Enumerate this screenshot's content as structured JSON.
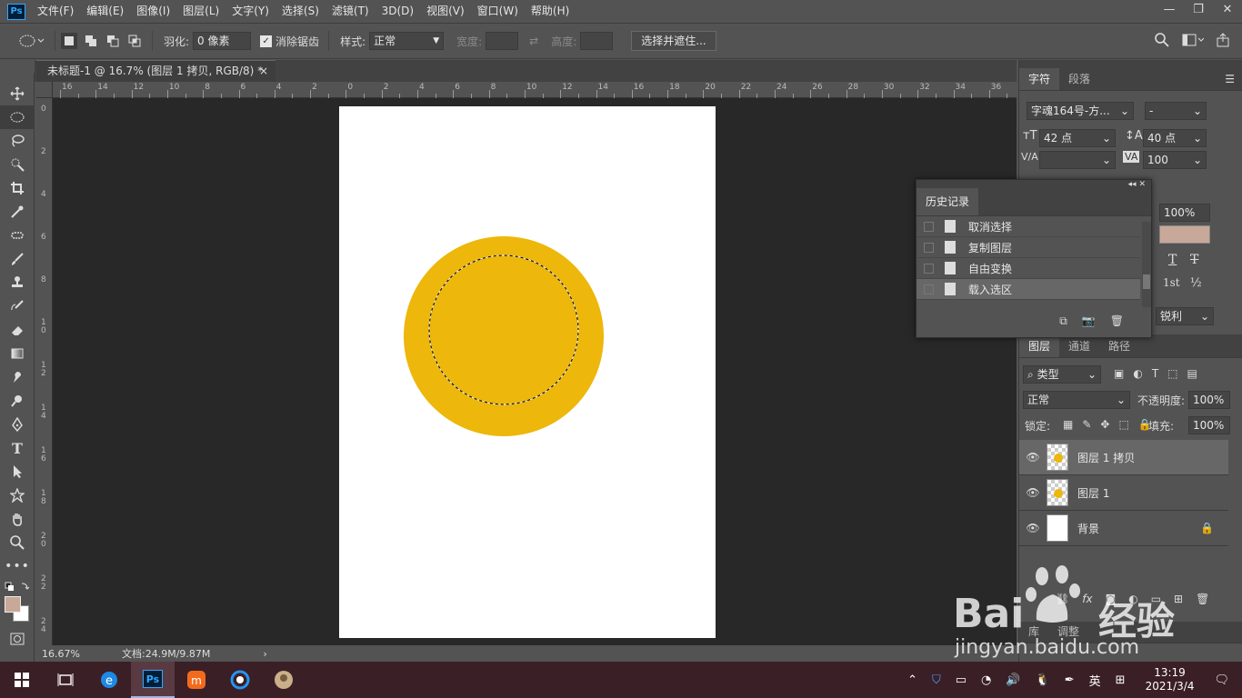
{
  "menubar": {
    "logo": "Ps",
    "items": [
      "文件(F)",
      "编辑(E)",
      "图像(I)",
      "图层(L)",
      "文字(Y)",
      "选择(S)",
      "滤镜(T)",
      "3D(D)",
      "视图(V)",
      "窗口(W)",
      "帮助(H)"
    ],
    "win": {
      "min": "—",
      "restore": "❐",
      "close": "✕"
    }
  },
  "options": {
    "feather_label": "羽化:",
    "feather_value": "0 像素",
    "antialias_label": "消除锯齿",
    "style_label": "样式:",
    "style_value": "正常",
    "width_label": "宽度:",
    "height_label": "高度:",
    "select_mask_button": "选择并遮住..."
  },
  "document": {
    "tab_title": "未标题-1 @ 16.7% (图层 1 拷贝, RGB/8) *",
    "close": "×",
    "zoom": "16.67%",
    "doc_info": "文档:24.9M/9.87M",
    "circle_color": "#edb70b"
  },
  "ruler_h": [
    "16",
    "14",
    "12",
    "10",
    "8",
    "6",
    "4",
    "2",
    "0",
    "2",
    "4",
    "6",
    "8",
    "10",
    "12",
    "14",
    "16",
    "18",
    "20",
    "22",
    "24",
    "26",
    "28",
    "30",
    "32",
    "34",
    "36"
  ],
  "ruler_v": [
    "0",
    "2",
    "4",
    "6",
    "8",
    "1\n0",
    "1\n2",
    "1\n4",
    "1\n6",
    "1\n8",
    "2\n0",
    "2\n2",
    "2\n4"
  ],
  "character": {
    "tabs": [
      "字符",
      "段落"
    ],
    "font_family": "字魂164号-方...",
    "font_style": "-",
    "size": "42 点",
    "leading": "40 点",
    "kerning": "",
    "tracking": "100",
    "scale": "100%",
    "color": "#c8a898",
    "aa": "锐利",
    "glyph_T": "T",
    "glyph_1st": "1st",
    "glyph_half": "½"
  },
  "history": {
    "title": "历史记录",
    "items": [
      "取消选择",
      "复制图层",
      "自由变换",
      "载入选区"
    ]
  },
  "layers": {
    "tabs": [
      "图层",
      "通道",
      "路径"
    ],
    "filter": "类型",
    "blend": "正常",
    "opacity_label": "不透明度:",
    "opacity": "100%",
    "lock_label": "锁定:",
    "fill_label": "填充:",
    "fill": "100%",
    "items": [
      {
        "name": "图层 1 拷贝"
      },
      {
        "name": "图层 1"
      },
      {
        "name": "背景"
      }
    ],
    "fx": "fx",
    "bottom_tabs": [
      "库",
      "调整"
    ]
  },
  "taskbar": {
    "time": "13:19",
    "date": "2021/3/4",
    "ime": "英",
    "ps": "Ps"
  },
  "watermark": {
    "brand": "Bai",
    "brand2": "经验",
    "url": "jingyan.baidu.com"
  }
}
